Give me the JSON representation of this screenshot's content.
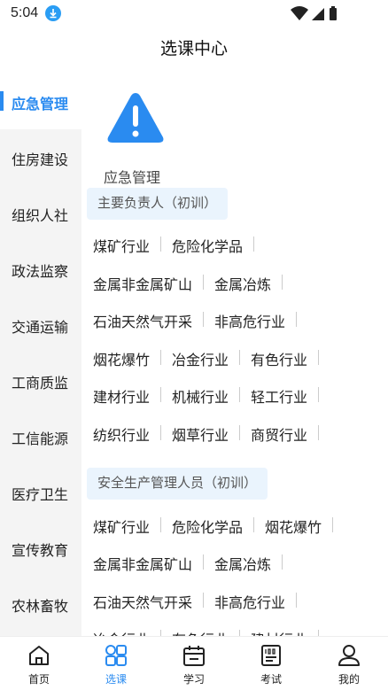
{
  "status_bar": {
    "time": "5:04"
  },
  "header": {
    "title": "选课中心"
  },
  "sidebar": {
    "items": [
      {
        "label": "应急管理",
        "active": true
      },
      {
        "label": "住房建设"
      },
      {
        "label": "组织人社"
      },
      {
        "label": "政法监察"
      },
      {
        "label": "交通运输"
      },
      {
        "label": "工商质监"
      },
      {
        "label": "工信能源"
      },
      {
        "label": "医疗卫生"
      },
      {
        "label": "宣传教育"
      },
      {
        "label": "农林畜牧"
      }
    ]
  },
  "category": {
    "label": "应急管理",
    "icon": "warning-icon"
  },
  "sections": [
    {
      "title": "主要负责人（初训）",
      "rows": [
        [
          "煤矿行业",
          "危险化学品"
        ],
        [
          "金属非金属矿山",
          "金属冶炼"
        ],
        [
          "石油天然气开采",
          "非高危行业"
        ],
        [
          "烟花爆竹",
          "冶金行业",
          "有色行业"
        ],
        [
          "建材行业",
          "机械行业",
          "轻工行业"
        ],
        [
          "纺织行业",
          "烟草行业",
          "商贸行业"
        ]
      ]
    },
    {
      "title": "安全生产管理人员（初训）",
      "rows": [
        [
          "煤矿行业",
          "危险化学品",
          "烟花爆竹"
        ],
        [
          "金属非金属矿山",
          "金属冶炼"
        ],
        [
          "石油天然气开采",
          "非高危行业"
        ],
        [
          "冶金行业",
          "有色行业",
          "建材行业"
        ]
      ]
    }
  ],
  "bottom_nav": {
    "items": [
      {
        "label": "首页",
        "icon": "home-icon"
      },
      {
        "label": "选课",
        "icon": "grid-icon",
        "active": true
      },
      {
        "label": "学习",
        "icon": "calendar-icon"
      },
      {
        "label": "考试",
        "icon": "exam-icon"
      },
      {
        "label": "我的",
        "icon": "user-icon"
      }
    ]
  },
  "colors": {
    "accent": "#2a8bf0",
    "chip_bg": "#eaf4fd",
    "sidebar_bg": "#f4f4f4"
  }
}
